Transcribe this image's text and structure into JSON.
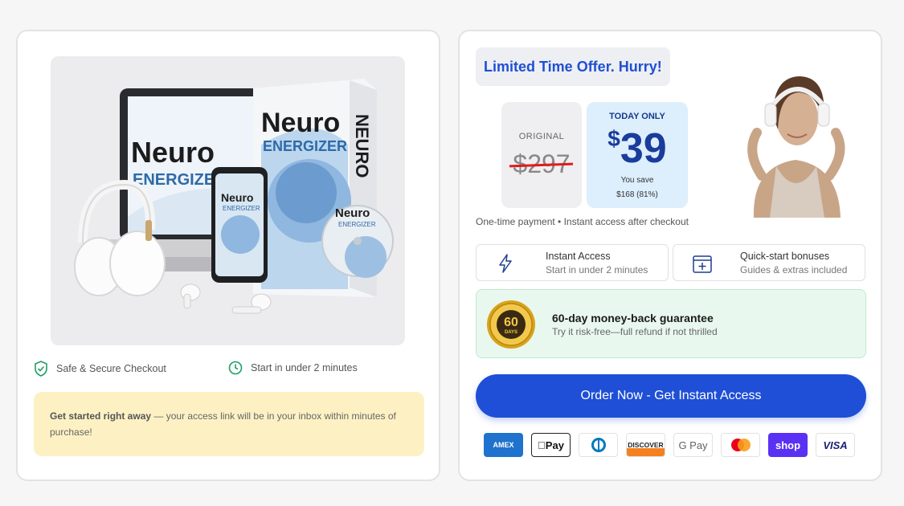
{
  "left_card": {
    "product_image": {
      "laptop_brand_line1": "Neuro",
      "laptop_brand_line2": "ENERGIZER",
      "box_brand_line1": "Neuro",
      "box_brand_line2": "ENERGIZER",
      "box_spine": "NEURO",
      "phone_brand_line1": "Neuro",
      "phone_brand_line2": "ENERGIZER",
      "disc_brand_line1": "Neuro",
      "disc_brand_line2": "ENERGIZER"
    },
    "trust": [
      {
        "label": "Safe & Secure Checkout",
        "icon": "shield-check-icon"
      },
      {
        "label": "Start in under 2 minutes",
        "icon": "clock-icon"
      }
    ],
    "note": {
      "bold": "Get started right away",
      "text": " — your access link will be in your inbox within minutes of purchase!"
    }
  },
  "right_card": {
    "offer_badge": "Limited Time Offer. Hurry!",
    "original": {
      "label": "ORIGINAL",
      "price": "$297"
    },
    "today": {
      "label": "TODAY ONLY",
      "currency": "$",
      "price": "39",
      "save_label": "You save",
      "save_value": "$168 (81%)"
    },
    "one_time": "One-time payment • Instant access after checkout",
    "features": [
      {
        "title": "Instant Access",
        "subtitle": "Start in under 2 minutes",
        "icon": "lightning-icon"
      },
      {
        "title": "Quick-start bonuses",
        "subtitle": "Guides & extras included",
        "icon": "gift-box-icon"
      }
    ],
    "guarantee": {
      "title": "60-day money-back guarantee",
      "subtitle": "Try it risk-free—full refund if not thrilled",
      "seal_number": "60",
      "seal_unit": "DAYS"
    },
    "order_button": "Order Now - Get Instant Access",
    "payments": [
      {
        "name": "amex",
        "label": "AMEX"
      },
      {
        "name": "apple-pay",
        "label": "Pay"
      },
      {
        "name": "diners",
        "label": ""
      },
      {
        "name": "discover",
        "label": "DISCOVER"
      },
      {
        "name": "google-pay",
        "label": "G Pay"
      },
      {
        "name": "mastercard",
        "label": ""
      },
      {
        "name": "shop-pay",
        "label": "shop"
      },
      {
        "name": "visa",
        "label": "VISA"
      }
    ]
  },
  "colors": {
    "accent": "#1f4fd6",
    "strike": "#e01b1b",
    "note_bg": "#fdf1c4",
    "guarantee_bg": "#e9f8ef",
    "today_bg": "#ddeefc"
  }
}
